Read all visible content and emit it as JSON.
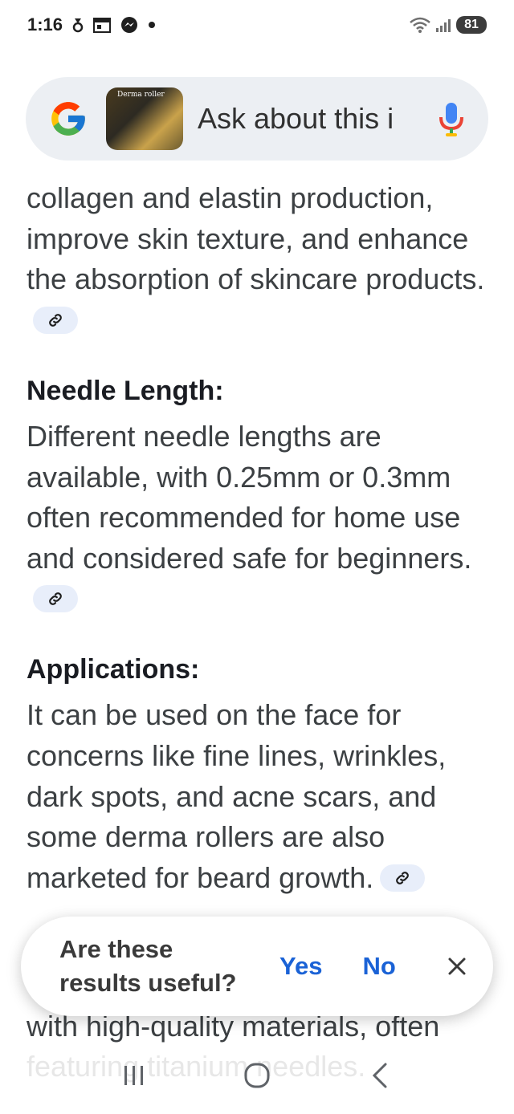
{
  "status_bar": {
    "time": "1:16",
    "icons": [
      "notification-icon",
      "calendar-icon",
      "messenger-icon",
      "dot-icon"
    ],
    "right_icons": [
      "wifi-icon",
      "signal-icon"
    ],
    "battery": "81"
  },
  "search": {
    "thumbnail_label": "Derma roller",
    "placeholder": "Ask about this i",
    "logo": "google-g-icon",
    "mic": "mic-icon"
  },
  "content": {
    "intro": "collagen and elastin production, improve skin texture, and enhance the absorption of skincare products.",
    "sections": [
      {
        "heading": "Needle Length:",
        "body": "Different needle lengths are available, with 0.25mm or 0.3mm often recommended for home use and considered safe for beginners."
      },
      {
        "heading": "Applications:",
        "body": "It can be used on the face for concerns like fine lines, wrinkles, dark spots, and acne scars, and some derma rollers are also marketed for beard growth."
      }
    ],
    "trailing_visible": "with high-quality materials, often",
    "trailing_faded": "featuring titanium needles."
  },
  "feedback": {
    "question": "Are these results useful?",
    "yes": "Yes",
    "no": "No",
    "close": "close-icon"
  },
  "nav": {
    "recents": "recents-icon",
    "home": "home-icon",
    "back": "back-icon"
  },
  "colors": {
    "accent": "#1a62d6",
    "pill_bg": "#eceff3",
    "chip_bg": "#e8eefa"
  }
}
